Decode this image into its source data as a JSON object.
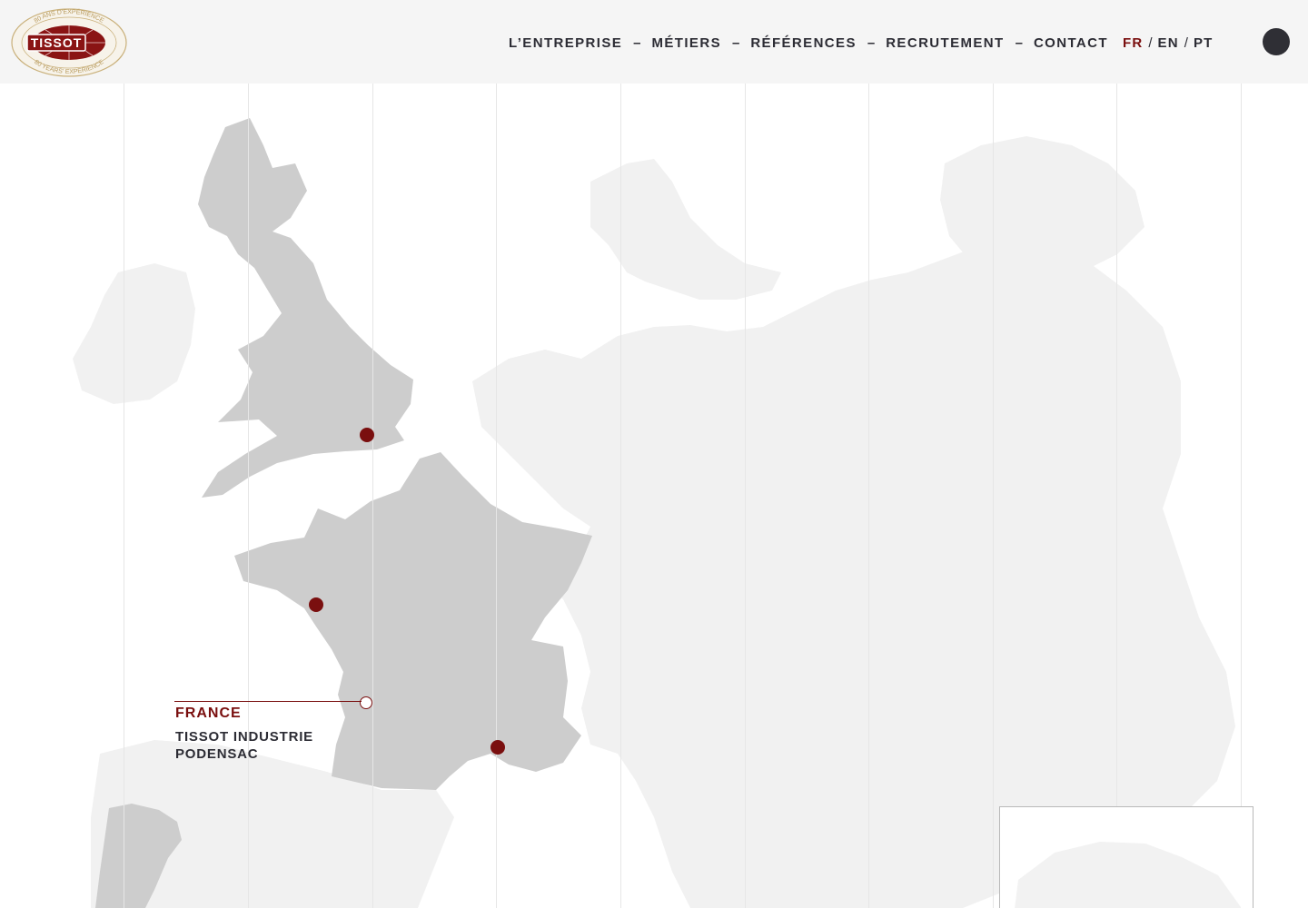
{
  "header": {
    "logo": {
      "brand": "TISSOT",
      "ring_top": "80 ANS D'EXPÉRIENCE",
      "ring_bottom": "80 YEARS' EXPERIENCE"
    },
    "nav": [
      "L’ENTREPRISE",
      "MÉTIERS",
      "RÉFÉRENCES",
      "RECRUTEMENT",
      "CONTACT"
    ],
    "nav_separator": "–",
    "languages": [
      "FR",
      "EN",
      "PT"
    ],
    "active_language": "FR",
    "lang_separator": "/"
  },
  "map": {
    "callout": {
      "country": "FRANCE",
      "site_line1": "TISSOT INDUSTRIE",
      "site_line2": "PODENSAC"
    }
  },
  "colors": {
    "accent": "#7a0f0f",
    "text": "#2c2c34",
    "land_highlight": "#cdcdcd",
    "land_background": "#f1f1f1",
    "header_bg": "#f5f5f5"
  }
}
